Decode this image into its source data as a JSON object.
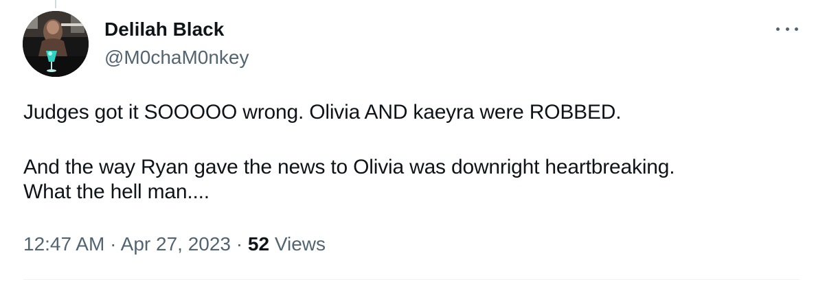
{
  "author": {
    "display_name": "Delilah Black",
    "handle": "@M0chaM0nkey",
    "avatar": "profile-photo"
  },
  "more_menu": {
    "icon": "ellipsis-icon"
  },
  "tweet": {
    "paragraphs": [
      "Judges got it SOOOOO wrong. Olivia AND kaeyra were ROBBED.",
      "And the way Ryan gave the news to Olivia was downright heartbreaking.",
      "What the hell man...."
    ]
  },
  "meta": {
    "time": "12:47 AM",
    "separator": "·",
    "date": "Apr 27, 2023",
    "views_count": "52",
    "views_label": "Views"
  },
  "colors": {
    "text_primary": "#0f1419",
    "text_secondary": "#536471",
    "divider": "#eff3f4"
  }
}
